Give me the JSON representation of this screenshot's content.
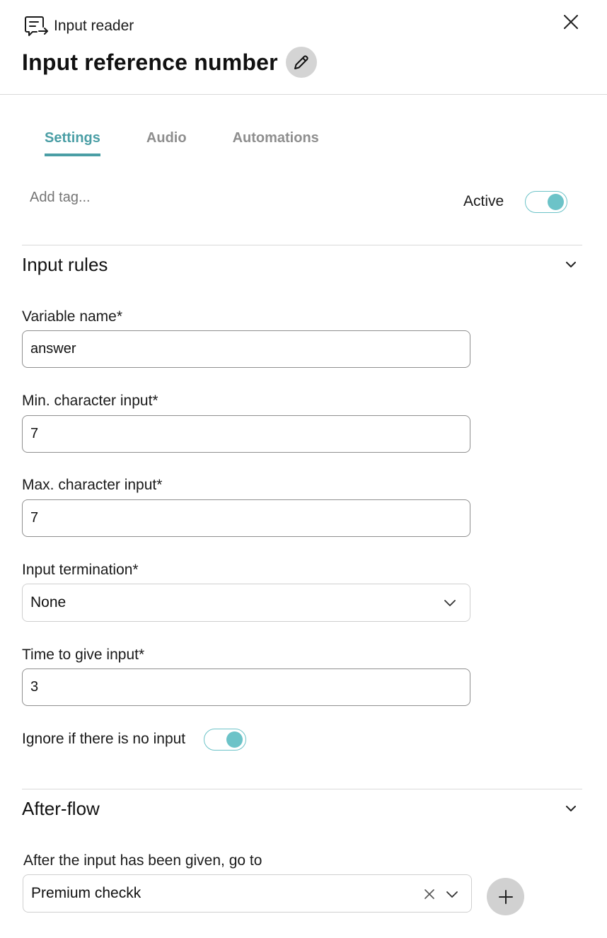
{
  "header": {
    "type_label": "Input reader",
    "title": "Input reference number"
  },
  "tabs": [
    {
      "label": "Settings",
      "active": true
    },
    {
      "label": "Audio",
      "active": false
    },
    {
      "label": "Automations",
      "active": false
    }
  ],
  "tags": {
    "placeholder": "Add tag...",
    "active_label": "Active",
    "active_on": true
  },
  "input_rules": {
    "title": "Input rules",
    "variable_name_label": "Variable name*",
    "variable_name_value": "answer",
    "min_label": "Min. character input*",
    "min_value": "7",
    "max_label": "Max. character input*",
    "max_value": "7",
    "termination_label": "Input termination*",
    "termination_value": "None",
    "time_label": "Time to give input*",
    "time_value": "3",
    "ignore_label": "Ignore if there is no input",
    "ignore_on": true
  },
  "after_flow": {
    "title": "After-flow",
    "goto_label": "After the input has been given, go to",
    "goto_value": "Premium checkk"
  },
  "colors": {
    "accent": "#4a9ea5",
    "toggle": "#6cc3c8",
    "icon_button_bg": "#d4d4d4"
  },
  "icons": {
    "type": "input-reader-icon",
    "close": "close-icon",
    "edit": "pencil-icon",
    "collapse": "chevron-down-icon",
    "clear": "clear-icon",
    "add": "plus-icon"
  }
}
